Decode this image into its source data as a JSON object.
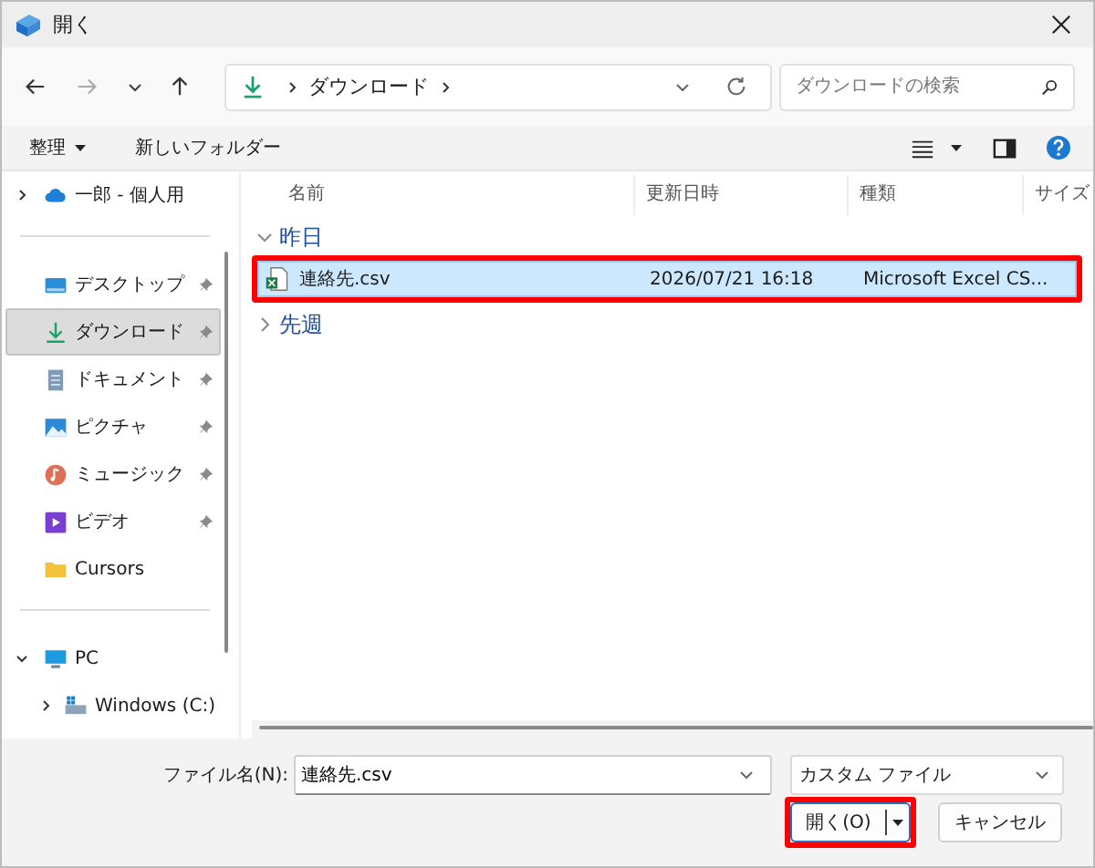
{
  "window": {
    "title": "開く"
  },
  "nav": {
    "back_enabled": true,
    "forward_enabled": false,
    "path": [
      "ダウンロード"
    ],
    "search": {
      "placeholder": "ダウンロードの検索"
    }
  },
  "toolbar": {
    "organize": "整理",
    "new_folder": "新しいフォルダー"
  },
  "sidebar": {
    "items": [
      {
        "kind": "cloud",
        "label": "一郎 - 個人用",
        "expanded": false,
        "selected": false
      },
      {
        "kind": "divider"
      },
      {
        "kind": "desktop",
        "label": "デスクトップ",
        "pinned": true,
        "selected": false
      },
      {
        "kind": "download",
        "label": "ダウンロード",
        "pinned": true,
        "selected": true
      },
      {
        "kind": "documents",
        "label": "ドキュメント",
        "pinned": true,
        "selected": false
      },
      {
        "kind": "pictures",
        "label": "ピクチャ",
        "pinned": true,
        "selected": false
      },
      {
        "kind": "music",
        "label": "ミュージック",
        "pinned": true,
        "selected": false
      },
      {
        "kind": "videos",
        "label": "ビデオ",
        "pinned": true,
        "selected": false
      },
      {
        "kind": "folder",
        "label": "Cursors",
        "pinned": false,
        "selected": false
      },
      {
        "kind": "divider"
      },
      {
        "kind": "pc",
        "label": "PC",
        "expanded": true,
        "selected": false,
        "children": [
          {
            "kind": "drive",
            "label": "Windows (C:)",
            "expanded": false,
            "selected": false
          }
        ]
      }
    ]
  },
  "table": {
    "columns": [
      "名前",
      "更新日時",
      "種類",
      "サイズ"
    ],
    "groups": [
      {
        "label": "昨日",
        "expanded": true,
        "rows": [
          {
            "name": "連絡先.csv",
            "modified": "2026/07/21 16:18",
            "type": "Microsoft Excel CS...",
            "selected": true,
            "highlighted": true
          }
        ]
      },
      {
        "label": "先週",
        "expanded": false
      }
    ]
  },
  "footer": {
    "filename_label": "ファイル名(N):",
    "filename": "連絡先.csv",
    "filetype": "カスタム ファイル",
    "buttons": [
      {
        "kind": "primary",
        "label": "開く(O)",
        "highlighted": true
      },
      {
        "kind": "secondary",
        "label": "キャンセル",
        "highlighted": false
      }
    ]
  }
}
